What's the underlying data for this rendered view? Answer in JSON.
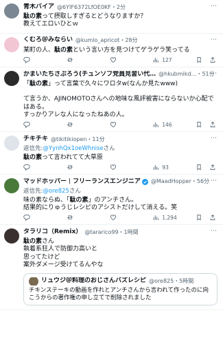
{
  "posts": [
    {
      "name": "青木バイア",
      "handle": "@6YIF6372LfOE0KF",
      "time": "2分",
      "text_before": "",
      "bold": "駄の素",
      "text_after": "って摂取しすぎるとどうなりますか？\n教えてエロいひとｗ",
      "show_actions": false,
      "avatar_color": "#7b8792"
    },
    {
      "name": "くむろ＠みならい",
      "handle": "@kumlo_apricot",
      "time": "28分",
      "text_before": "某町の人、",
      "bold": "駄の素",
      "text_after": "という言い方を見つけてゲラゲラ笑ってる",
      "counts": {
        "reply": "",
        "retweet": "",
        "like": "",
        "views": "127"
      },
      "show_actions": true,
      "avatar_color": "#f3c6d3"
    },
    {
      "name": "かまいたちさぶろう(チュンソフ党員見習い代…",
      "handle": "@hkubmikd…",
      "time": "51分",
      "text_before": "「",
      "bold": "駄の素",
      "text_after": "」って言葉で久々にワロタw(なんか見たwww)\n\nて言うか、AJINOMOTOさんへの地味な風評被害にならないか心配ではある。\nすっかりアレな人になったねあの人。",
      "counts": {
        "reply": "",
        "retweet": "",
        "like": "",
        "views": "146"
      },
      "show_actions": true,
      "avatar_color": "#2b2b2b"
    },
    {
      "name": "チキチキ",
      "handle": "@tikitikiopen",
      "time": "11分",
      "reply_to_label": "返信先:",
      "reply_to": "@YynhQx1oeWhnise",
      "reply_suffix": "さん",
      "text_before": "",
      "bold": "駄の素",
      "text_after": "って言われてて大草原",
      "counts": {
        "reply": "",
        "retweet": "",
        "like": "",
        "views": "93"
      },
      "show_actions": true,
      "avatar_color": "#dfe4ea"
    },
    {
      "name": "マッドホッパー｜フリーランスエンジニア",
      "handle": "@MaadHopper",
      "time": "56分",
      "reply_to_label": "返信先:",
      "reply_to": "@ore825",
      "reply_suffix": "さん",
      "text_before": "味の素ならぬ、「",
      "bold": "駄の素",
      "text_after": "」のアンチさん。\n結果的にりゅうじレシピのアシストだけして消える。笑",
      "counts": {
        "reply": "",
        "retweet": "",
        "like": "",
        "views": "1,294"
      },
      "show_actions": true,
      "avatar_color": "#4a7a3a"
    },
    {
      "name": "タラリコ（Remix）",
      "handle": "@tararico99",
      "time": "1時間",
      "text_before": "",
      "bold": "駄の素",
      "text_after": "さん\n執着系狂人で防御力高いと\n思ってたけど\n案外ダメージ受けてるんやな",
      "show_actions": false,
      "avatar_color": "#3b3030",
      "quote": {
        "name": "リュウジ＠料理のおじさんバズレシピ",
        "handle": "@ore825",
        "time": "5時間",
        "text": "チキンステーキの動画を作れとアンチさんから言われて作ったのに向こうからの著作権の申し立てで削除されました"
      }
    }
  ],
  "icons": {
    "reply": "reply-icon",
    "retweet": "retweet-icon",
    "like": "like-icon",
    "views": "views-icon",
    "bookmark": "bookmark-icon",
    "share": "share-icon",
    "more": "more-icon"
  },
  "colors": {
    "link": "#1d9bf0",
    "muted": "#536471",
    "verified": "#1d9bf0"
  }
}
